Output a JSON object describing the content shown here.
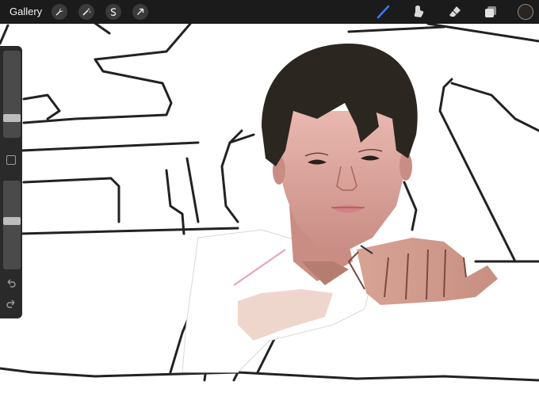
{
  "topbar": {
    "gallery_label": "Gallery",
    "left_tools": [
      {
        "name": "actions",
        "icon": "wrench-icon"
      },
      {
        "name": "adjustments",
        "icon": "magic-wand-icon"
      },
      {
        "name": "selection",
        "icon": "selection-s-icon"
      },
      {
        "name": "transform",
        "icon": "arrow-cursor-icon"
      }
    ],
    "right_tools": [
      {
        "name": "brush",
        "icon": "brush-icon",
        "active": true
      },
      {
        "name": "smudge",
        "icon": "smudge-icon"
      },
      {
        "name": "eraser",
        "icon": "eraser-icon"
      },
      {
        "name": "layers",
        "icon": "layers-icon"
      }
    ],
    "color_swatch": "#2a2520",
    "accent": "#2f7cf6"
  },
  "sidebar": {
    "brush_size_slider": {
      "icon": "size-slider",
      "level": 0.25
    },
    "opacity_slider": {
      "icon": "opacity-slider",
      "level": 0.45
    },
    "modify_icon": "square-modify-icon",
    "undo_icon": "undo-arrow-icon",
    "redo_icon": "redo-arrow-icon"
  }
}
